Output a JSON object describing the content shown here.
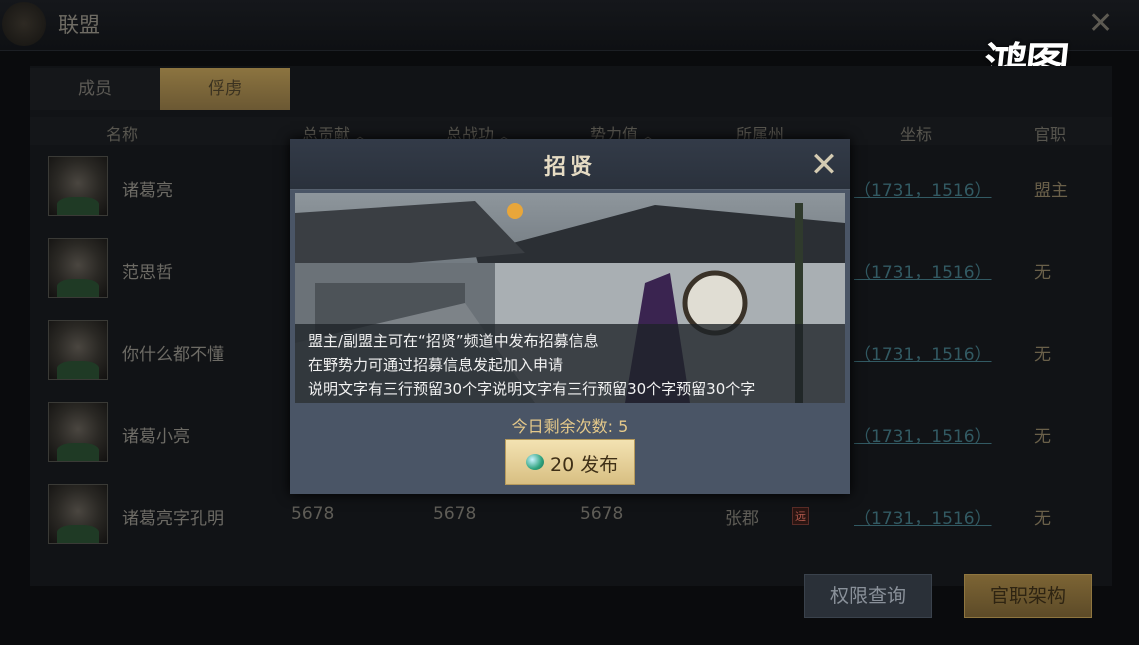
{
  "window": {
    "title": "联盟",
    "close_icon": "close-icon"
  },
  "logo": {
    "text": "鸿图之下"
  },
  "tabs": [
    {
      "label": "成员",
      "active": false
    },
    {
      "label": "俘虏",
      "active": true
    }
  ],
  "table": {
    "headers": [
      "名称",
      "总贡献",
      "总战功",
      "势力值",
      "所属州",
      "坐标",
      "官职"
    ],
    "sort_icon": "chevron-up-icon",
    "rows": [
      {
        "name": "诸葛亮",
        "contribution": "",
        "merit": "",
        "power": "",
        "state": "",
        "coord": "（1731，1516）",
        "rank": "盟主"
      },
      {
        "name": "范思哲",
        "contribution": "",
        "merit": "",
        "power": "",
        "state": "",
        "coord": "（1731，1516）",
        "rank": "无"
      },
      {
        "name": "你什么都不懂",
        "contribution": "",
        "merit": "",
        "power": "",
        "state": "",
        "coord": "（1731，1516）",
        "rank": "无"
      },
      {
        "name": "诸葛小亮",
        "contribution": "",
        "merit": "",
        "power": "",
        "state": "",
        "coord": "（1731，1516）",
        "rank": "无"
      },
      {
        "name": "诸葛亮字孔明",
        "contribution": "5678",
        "merit": "5678",
        "power": "5678",
        "state": "张郡",
        "tag": "远",
        "coord": "（1731，1516）",
        "rank": "无"
      }
    ]
  },
  "buttons": {
    "permissions": "权限查询",
    "office": "官职架构"
  },
  "modal": {
    "title": "招贤",
    "close_icon": "shuriken-close-icon",
    "lines": [
      "盟主/副盟主可在“招贤”频道中发布招募信息",
      "在野势力可通过招募信息发起加入申请",
      "说明文字有三行预留30个字说明文字有三行预留30个字预留30个字"
    ],
    "remaining": "今日剩余次数: 5",
    "publish": "20 发布",
    "publish_icon": "jade-gem-icon"
  },
  "colors": {
    "gold": "#e5c98a",
    "link": "#325a63",
    "modal_bg": "#4a5566"
  }
}
